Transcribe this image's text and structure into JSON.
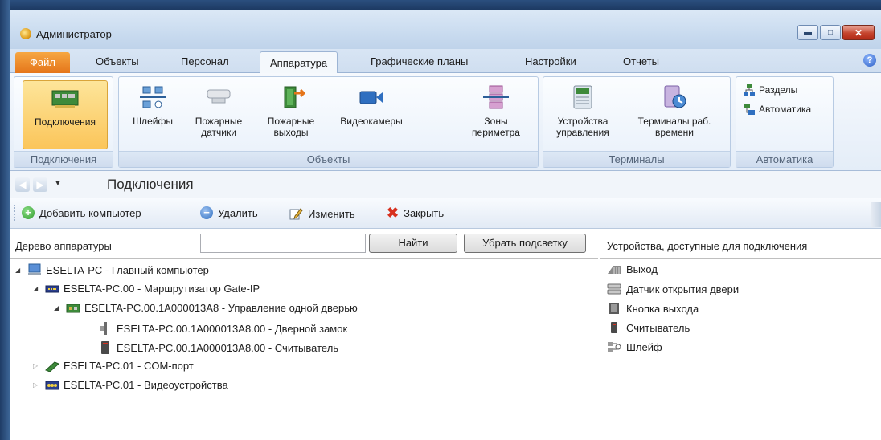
{
  "window": {
    "title": "Администратор"
  },
  "tabs": {
    "file": "Файл",
    "items": [
      "Объекты",
      "Персонал",
      "Аппаратура",
      "Графические планы",
      "Настройки",
      "Отчеты"
    ],
    "active": "Аппаратура"
  },
  "ribbon": {
    "groups": {
      "connections": "Подключения",
      "objects": "Объекты",
      "terminals": "Терминалы",
      "automation": "Автоматика"
    },
    "buttons": {
      "connections": "Подключения",
      "loops": "Шлейфы",
      "fire_detectors": [
        "Пожарные",
        "датчики"
      ],
      "fire_exits": [
        "Пожарные",
        "выходы"
      ],
      "cameras": "Видеокамеры",
      "perimeter": [
        "Зоны",
        "периметра"
      ],
      "control_devices": [
        "Устройства",
        "управления"
      ],
      "time_terminals": [
        "Терминалы раб.",
        "времени"
      ],
      "sections": "Разделы",
      "automation": "Автоматика"
    }
  },
  "nav": {
    "title": "Подключения"
  },
  "toolbar": {
    "add": "Добавить компьютер",
    "delete": "Удалить",
    "edit": "Изменить",
    "close": "Закрыть"
  },
  "tree_pane": {
    "label": "Дерево аппаратуры",
    "search_value": "",
    "find_button": "Найти",
    "clear_button": "Убрать подсветку",
    "nodes": [
      "ESELTA-PC - Главный компьютер",
      "ESELTA-PC.00 - Маршрутизатор Gate-IP",
      "ESELTA-PC.00.1A000013A8 - Управление одной дверью",
      "ESELTA-PC.00.1A000013A8.00 - Дверной замок",
      "ESELTA-PC.00.1A000013A8.00 - Считыватель",
      "ESELTA-PC.01 - COM-порт",
      "ESELTA-PC.01 - Видеоустройства"
    ]
  },
  "devices_pane": {
    "header": "Устройства, доступные для подключения",
    "items": [
      "Выход",
      "Датчик открытия двери",
      "Кнопка выхода",
      "Считыватель",
      "Шлейф"
    ]
  }
}
